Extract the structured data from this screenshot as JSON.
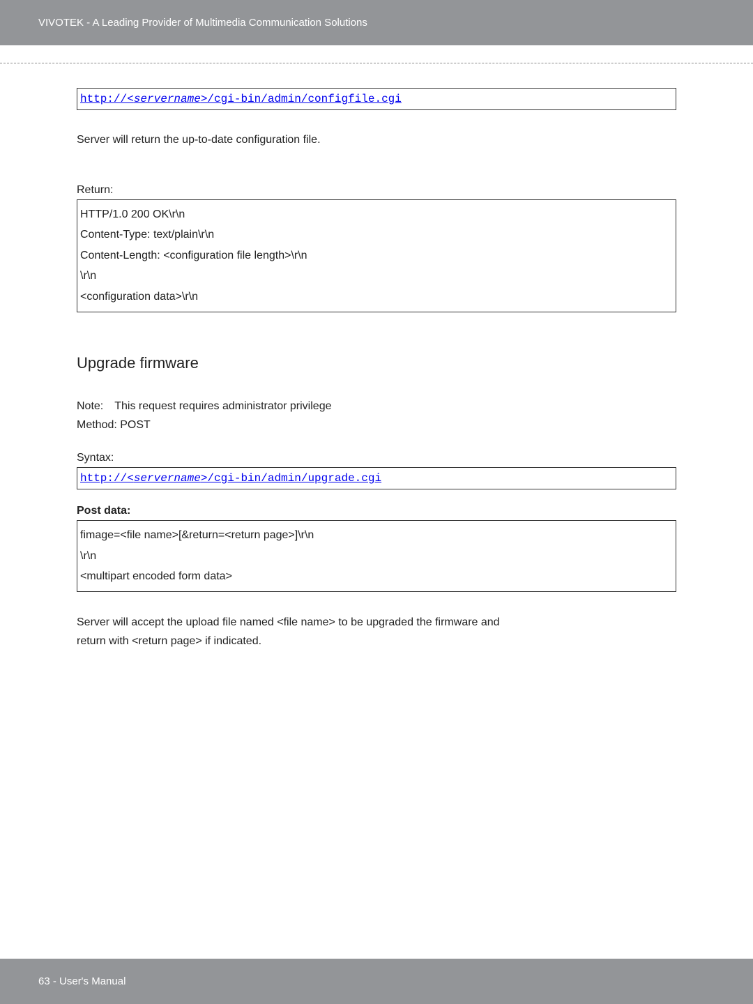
{
  "header": {
    "text": "VIVOTEK - A Leading Provider of Multimedia Communication Solutions"
  },
  "url1_prefix": "http://<",
  "url1_server": "servername",
  "url1_suffix": ">/cgi-bin/admin/configfile.cgi",
  "para1": "Server will return the up-to-date configuration file.",
  "return_label": "Return:",
  "return_box": {
    "l1": "HTTP/1.0 200 OK\\r\\n",
    "l2": "Content-Type: text/plain\\r\\n",
    "l3": "Content-Length: <configuration file length>\\r\\n",
    "l4": "\\r\\n",
    "l5": "<configuration data>\\r\\n"
  },
  "section_title": "Upgrade firmware",
  "note_line1": "Note: This request requires administrator privilege",
  "note_line2": "Method: POST",
  "syntax_label": "Syntax:",
  "url2_prefix": "http://<",
  "url2_server": "servername",
  "url2_suffix": ">/cgi-bin/admin/upgrade.cgi",
  "post_label": "Post data:",
  "post_box": {
    "l1": "fimage=<file name>[&return=<return page>]\\r\\n",
    "l2": "\\r\\n",
    "l3": "<multipart encoded form data>"
  },
  "para2_l1": "Server will accept the upload file named <file name> to be upgraded the firmware and",
  "para2_l2": "return with <return page> if indicated.",
  "footer": {
    "text": "63 - User's Manual"
  }
}
